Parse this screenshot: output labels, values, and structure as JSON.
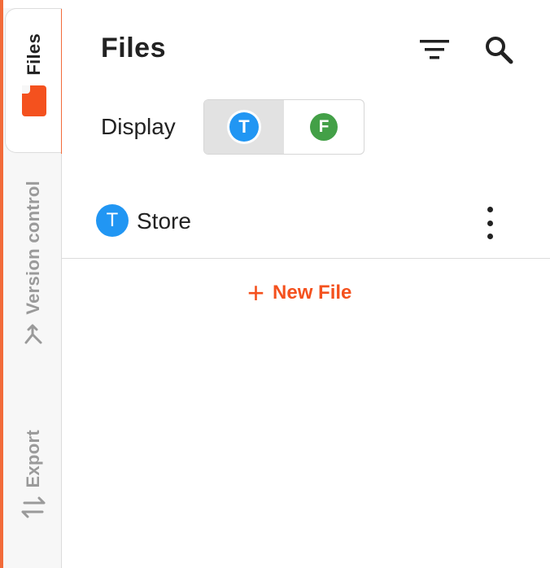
{
  "rail": {
    "tabs": [
      {
        "label": "Files",
        "icon": "folder-icon",
        "active": true
      },
      {
        "label": "Version control",
        "icon": "branch-icon",
        "active": false
      },
      {
        "label": "Export",
        "icon": "swap-arrows-icon",
        "active": false
      }
    ]
  },
  "header": {
    "title": "Files",
    "filter_icon": "filter-icon",
    "search_icon": "search-icon"
  },
  "display": {
    "label": "Display",
    "options": [
      {
        "letter": "T",
        "color": "#2196f3",
        "selected": true
      },
      {
        "letter": "F",
        "color": "#43a047",
        "selected": false
      }
    ]
  },
  "files": [
    {
      "badge": "T",
      "badge_color": "#2196f3",
      "name": "Store"
    }
  ],
  "new_file": {
    "icon": "+",
    "label": "New File"
  },
  "colors": {
    "accent": "#f4511e",
    "rail_active_bar": "#f26b3a"
  }
}
